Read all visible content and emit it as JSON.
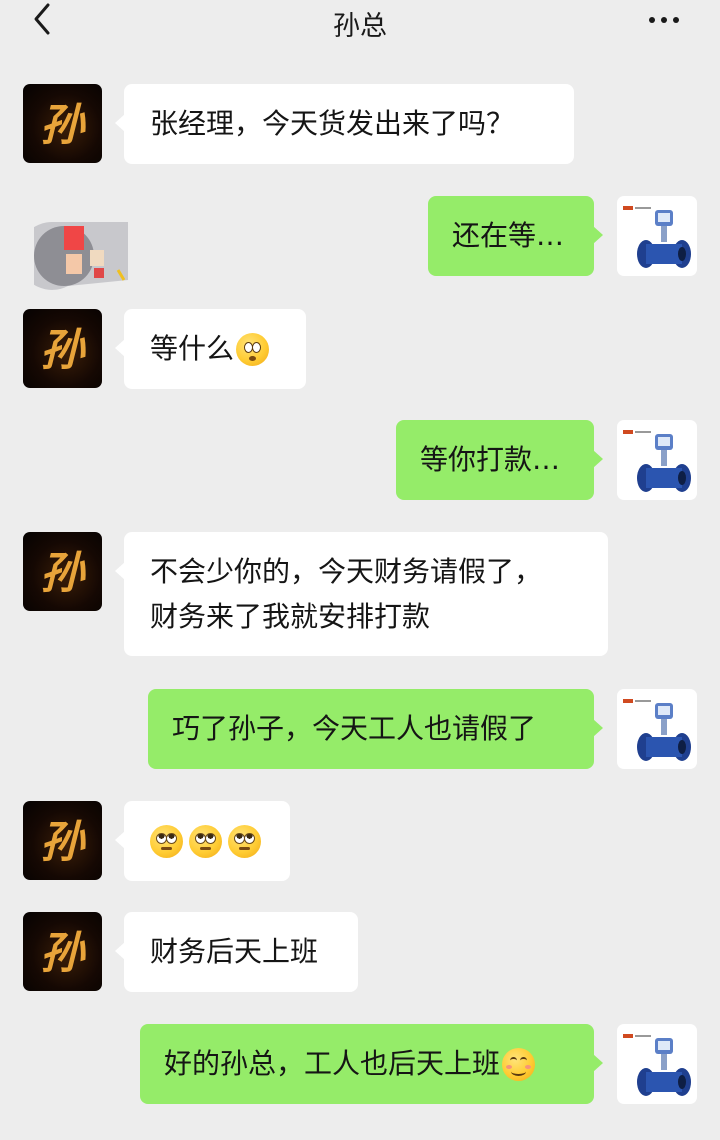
{
  "header": {
    "title": "孙总",
    "back_icon": "chevron-left-icon",
    "more_icon": "more-dots-icon"
  },
  "contact_avatar_text": "孙",
  "messages": [
    {
      "from": "contact",
      "text": "张经理，今天货发出来了吗？"
    },
    {
      "from": "me",
      "text": "还在等…"
    },
    {
      "from": "contact",
      "text": "等什么",
      "emoji": "flushed-face"
    },
    {
      "from": "me",
      "text": "等你打款…"
    },
    {
      "from": "contact",
      "lines": [
        "不会少你的，今天财务请假了，",
        "财务来了我就安排打款"
      ]
    },
    {
      "from": "me",
      "text": "巧了孙子，今天工人也请假了"
    },
    {
      "from": "contact",
      "emojis": [
        "face-with-rolling-eyes",
        "face-with-rolling-eyes",
        "face-with-rolling-eyes"
      ]
    },
    {
      "from": "contact",
      "text": "财务后天上班"
    },
    {
      "from": "me",
      "text": "好的孙总，工人也后天上班",
      "emoji": "smiling-face"
    }
  ],
  "colors": {
    "background": "#ededed",
    "incoming_bubble": "#ffffff",
    "outgoing_bubble": "#95ec69"
  }
}
